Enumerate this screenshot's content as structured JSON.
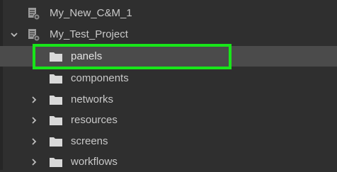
{
  "tree": {
    "items": [
      {
        "label": "My_New_C&M_1",
        "icon": "project-icon",
        "expander": "none"
      },
      {
        "label": "My_Test_Project",
        "icon": "project-icon",
        "expander": "expanded"
      },
      {
        "label": "panels",
        "icon": "folder-icon",
        "expander": "none",
        "selected": true
      },
      {
        "label": "components",
        "icon": "folder-icon",
        "expander": "none"
      },
      {
        "label": "networks",
        "icon": "folder-icon",
        "expander": "collapsed"
      },
      {
        "label": "resources",
        "icon": "folder-icon",
        "expander": "collapsed"
      },
      {
        "label": "screens",
        "icon": "folder-icon",
        "expander": "collapsed"
      },
      {
        "label": "workflows",
        "icon": "folder-icon",
        "expander": "collapsed"
      }
    ]
  },
  "colors": {
    "background": "#2f2f2f",
    "selected_row": "#4b4b4b",
    "highlight_border": "#18e619",
    "folder": "#d9d9d9",
    "text": "#c9c9c9"
  }
}
